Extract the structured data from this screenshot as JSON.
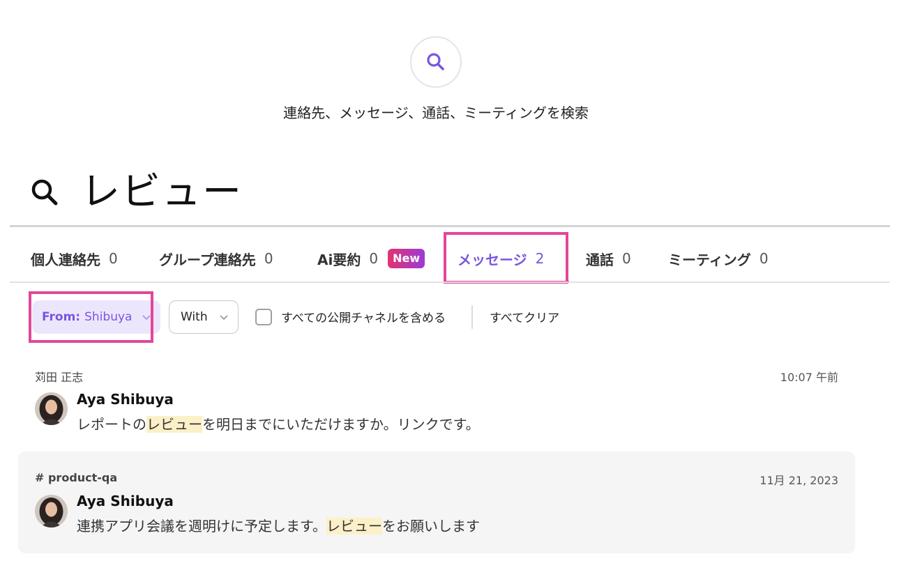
{
  "hint": {
    "icon": "search-icon",
    "text": "連絡先、メッセージ、通話、ミーティングを検索"
  },
  "query": {
    "icon": "search-icon",
    "text": "レビュー"
  },
  "tabs": [
    {
      "label": "個人連絡先",
      "count": "0"
    },
    {
      "label": "グループ連絡先",
      "count": "0"
    },
    {
      "label": "Ai要約",
      "count": "0",
      "badge": "New"
    },
    {
      "label": "メッセージ",
      "count": "2",
      "active": true
    },
    {
      "label": "通話",
      "count": "0"
    },
    {
      "label": "ミーティング",
      "count": "0"
    }
  ],
  "filters": {
    "from_label": "From:",
    "from_value": "Shibuya",
    "with_label": "With",
    "include_public_label": "すべての公開チャネルを含める",
    "include_public_checked": false,
    "clear_label": "すべてクリア"
  },
  "results": [
    {
      "context": "苅田 正志",
      "time": "10:07 午前",
      "sender": "Aya Shibuya",
      "message_before": "レポートの",
      "message_highlight": "レビュー",
      "message_after": "を明日までにいただけますか。リンクです。"
    },
    {
      "context": "# product-qa",
      "time": "11月 21, 2023",
      "sender": "Aya Shibuya",
      "message_before": "連携アプリ会議を週明けに予定します。",
      "message_highlight": "レビュー",
      "message_after": "をお願いします"
    }
  ],
  "colors": {
    "accent": "#7a55e0",
    "highlight_box": "#e0489a",
    "match_highlight": "#fbf0c8"
  }
}
